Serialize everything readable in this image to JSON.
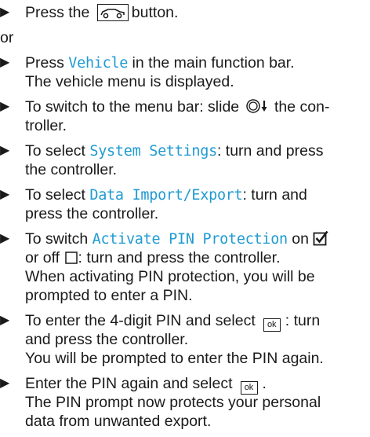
{
  "bullet_glyph": "▶",
  "icons": {
    "car_button": "car-button-icon",
    "controller_slide": "controller-slide-down-icon",
    "checkbox_checked": "checkbox-checked-icon",
    "checkbox_empty": "checkbox-empty-icon"
  },
  "text_colors": {
    "menu_item": "#1f9bd1",
    "body": "#1a1a1a"
  },
  "s1": {
    "a": "Press the",
    "b": "button."
  },
  "or": "or",
  "s2": {
    "a": "Press ",
    "menu": "Vehicle",
    "b": " in the main function bar.",
    "result": "The vehicle menu is displayed."
  },
  "s3": {
    "a": "To switch to the menu bar: slide",
    "b": " the con-",
    "c": "troller."
  },
  "s4": {
    "a": "To select ",
    "menu": "System Settings",
    "b": ": turn and press",
    "c": "the controller."
  },
  "s5": {
    "a": "To select ",
    "menu": "Data Import/Export",
    "b": ": turn and",
    "c": "press the controller."
  },
  "s6": {
    "a": "To switch ",
    "menu": "Activate PIN Protection",
    "b": " on",
    "c": "or off",
    "d": ": turn and press the controller.",
    "e": "When activating PIN protection, you will be",
    "f": "prompted to enter a PIN."
  },
  "s7": {
    "a": "To enter the 4-digit PIN and select",
    "ok": "ok",
    "b": ": turn",
    "c": "and press the controller.",
    "d": "You will be prompted to enter the PIN again."
  },
  "s8": {
    "a": "Enter the PIN again and select",
    "ok": "ok",
    "b": ".",
    "c": "The PIN prompt now protects your personal",
    "d": "data from unwanted export."
  }
}
